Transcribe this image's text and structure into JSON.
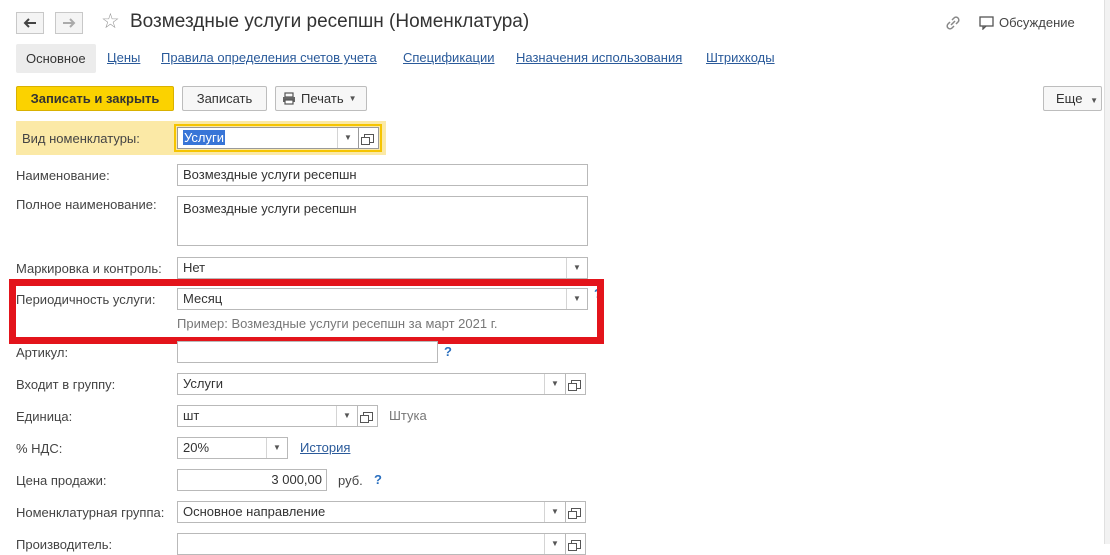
{
  "header": {
    "back_icon": "arrow-left-icon",
    "forward_icon": "arrow-right-icon",
    "favorite_icon": "star-icon",
    "title": "Возмездные услуги ресепшн (Номенклатура)",
    "link_icon": "link-icon",
    "discussion_label": "Обсуждение"
  },
  "tabs": [
    "Основное",
    "Цены",
    "Правила определения счетов учета",
    "Спецификации",
    "Назначения использования",
    "Штрихкоды"
  ],
  "toolbar": {
    "save_close": "Записать и закрыть",
    "save": "Записать",
    "print": "Печать",
    "more": "Еще"
  },
  "form": {
    "kind_label": "Вид номенклатуры:",
    "kind_value": "Услуги",
    "name_label": "Наименование:",
    "name_value": "Возмездные услуги ресепшн",
    "fullname_label": "Полное наименование:",
    "fullname_value": "Возмездные услуги ресепшн",
    "marking_label": "Маркировка и контроль:",
    "marking_value": "Нет",
    "period_label": "Периодичность услуги:",
    "period_value": "Месяц",
    "period_hint": "Пример: Возмездные услуги ресепшн за март 2021 г.",
    "article_label": "Артикул:",
    "article_value": "",
    "group_label": "Входит в группу:",
    "group_value": "Услуги",
    "unit_label": "Единица:",
    "unit_value": "шт",
    "unit_desc": "Штука",
    "vat_label": "% НДС:",
    "vat_value": "20%",
    "vat_history": "История",
    "price_label": "Цена продажи:",
    "price_value": "3 000,00",
    "price_currency": "руб.",
    "nomgroup_label": "Номенклатурная группа:",
    "nomgroup_value": "Основное направление",
    "maker_label": "Производитель:",
    "maker_value": "",
    "help_mark": "?"
  },
  "colors": {
    "primary_button": "#fbd200",
    "highlight_row": "#fbe9a6",
    "red_annotation": "#e3141b",
    "link": "#2a5a9a"
  }
}
